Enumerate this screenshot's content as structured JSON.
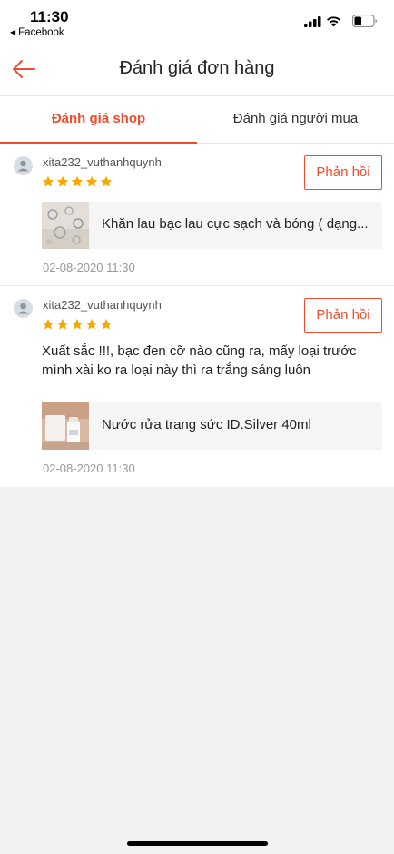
{
  "status_bar": {
    "time": "11:30",
    "back_app": "Facebook",
    "icons": [
      "signal-icon",
      "wifi-icon",
      "battery-icon"
    ]
  },
  "nav": {
    "title": "Đánh giá đơn hàng",
    "back_icon": "arrow-left-icon"
  },
  "tabs": [
    {
      "label": "Đánh giá shop",
      "active": true
    },
    {
      "label": "Đánh giá người mua",
      "active": false
    }
  ],
  "reviews": [
    {
      "username": "xita232_vuthanhquynh",
      "rating": 5,
      "reply_label": "Phản hồi",
      "text": "",
      "product_name": "Khăn lau bạc lau cực sạch và bóng ( dạng...",
      "date": "02-08-2020 11:30"
    },
    {
      "username": "xita232_vuthanhquynh",
      "rating": 5,
      "reply_label": "Phản hồi",
      "text": "Xuất sắc !!!, bạc đen cỡ nào cũng ra, mấy loại trước mình xài ko ra loại này thì ra trắng sáng luôn",
      "product_name": "Nước rửa trang sức ID.Silver 40ml",
      "date": "02-08-2020 11:30"
    }
  ],
  "colors": {
    "accent": "#ee4d2d",
    "star": "#f6a700",
    "background": "#f2f2f2"
  }
}
